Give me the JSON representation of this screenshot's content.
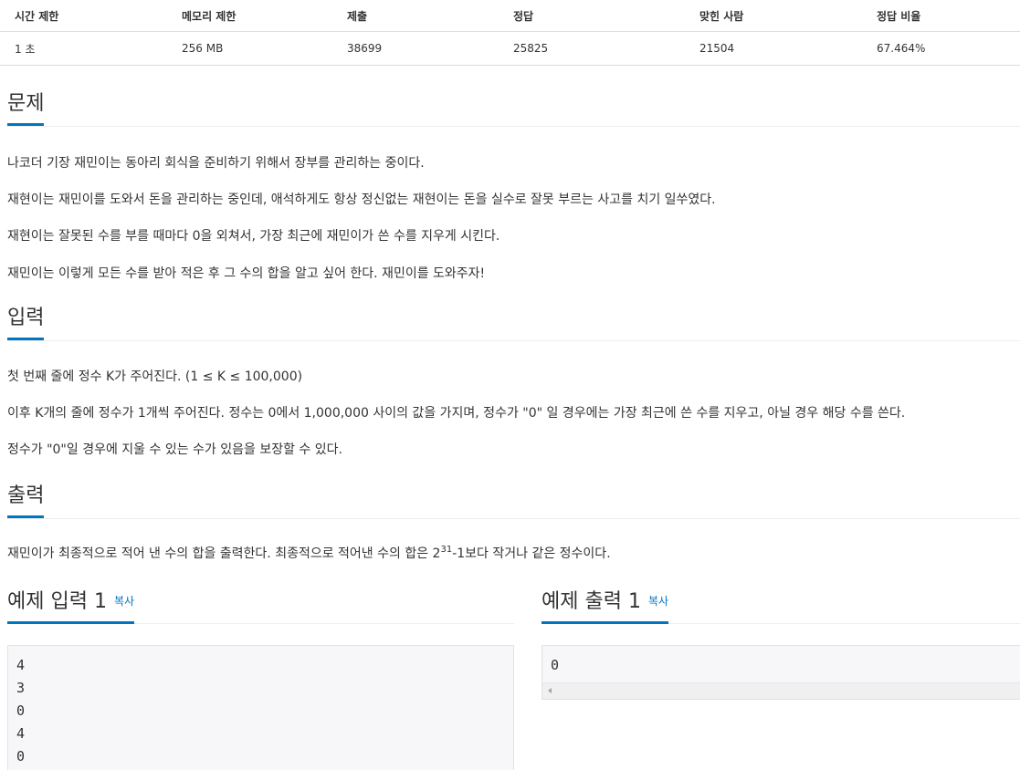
{
  "stats": {
    "headers": [
      "시간 제한",
      "메모리 제한",
      "제출",
      "정답",
      "맞힌 사람",
      "정답 비율"
    ],
    "values": [
      "1 초",
      "256 MB",
      "38699",
      "25825",
      "21504",
      "67.464%"
    ]
  },
  "problem": {
    "title": "문제",
    "paragraphs": [
      "나코더 기장 재민이는 동아리 회식을 준비하기 위해서 장부를 관리하는 중이다.",
      "재현이는 재민이를 도와서 돈을 관리하는 중인데, 애석하게도 항상 정신없는 재현이는 돈을 실수로 잘못 부르는 사고를 치기 일쑤였다.",
      "재현이는 잘못된 수를 부를 때마다 0을 외쳐서, 가장 최근에 재민이가 쓴 수를 지우게 시킨다.",
      "재민이는 이렇게 모든 수를 받아 적은 후 그 수의 합을 알고 싶어 한다. 재민이를 도와주자!"
    ]
  },
  "input": {
    "title": "입력",
    "paragraphs": [
      "첫 번째 줄에 정수 K가 주어진다. (1 ≤ K ≤ 100,000)",
      "이후 K개의 줄에 정수가 1개씩 주어진다. 정수는 0에서 1,000,000 사이의 값을 가지며, 정수가 \"0\" 일 경우에는 가장 최근에 쓴 수를 지우고, 아닐 경우 해당 수를 쓴다.",
      "정수가 \"0\"일 경우에 지울 수 있는 수가 있음을 보장할 수 있다."
    ]
  },
  "output": {
    "title": "출력",
    "text_before": "재민이가 최종적으로 적어 낸 수의 합을 출력한다. 최종적으로 적어낸 수의 합은 2",
    "sup": "31",
    "text_after": "-1보다 작거나 같은 정수이다."
  },
  "sample_input": {
    "title": "예제 입력 1",
    "copy_label": "복사",
    "lines": [
      "4",
      "3",
      "0",
      "4",
      "0"
    ]
  },
  "sample_output": {
    "title": "예제 출력 1",
    "copy_label": "복사",
    "lines": [
      "0"
    ]
  }
}
